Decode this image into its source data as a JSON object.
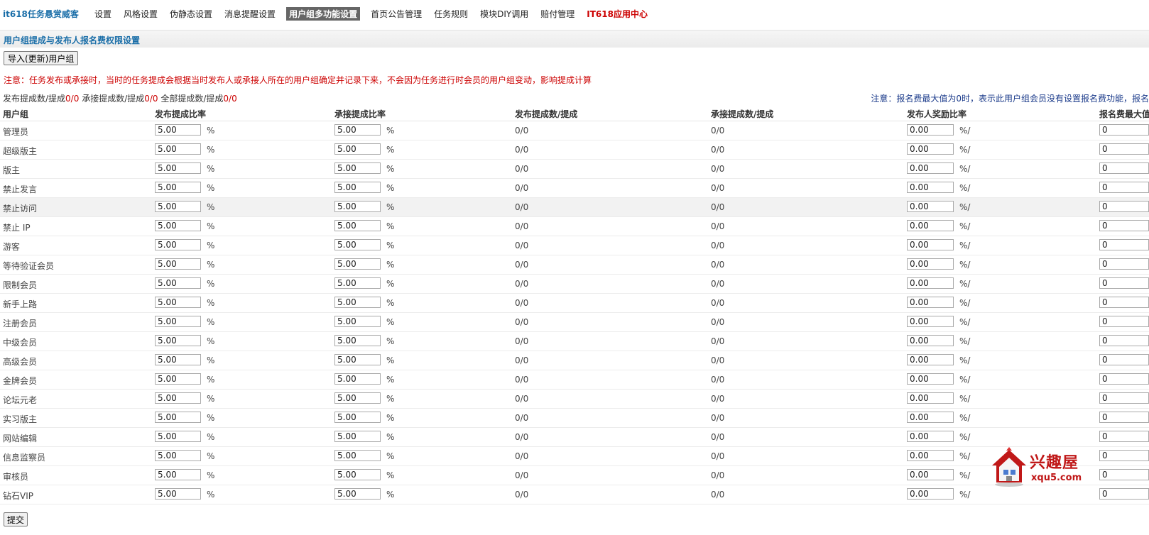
{
  "nav": {
    "brand": "it618任务悬赏威客",
    "items": [
      {
        "label": "设置"
      },
      {
        "label": "风格设置"
      },
      {
        "label": "伪静态设置"
      },
      {
        "label": "消息提醒设置"
      },
      {
        "label": "用户组多功能设置",
        "active": true
      },
      {
        "label": "首页公告管理"
      },
      {
        "label": "任务规则"
      },
      {
        "label": "模块DIY调用"
      },
      {
        "label": "赔付管理"
      },
      {
        "label": "IT618应用中心",
        "highlight": true
      }
    ]
  },
  "section_title": "用户组提成与发布人报名费权限设置",
  "import_button": "导入(更新)用户组",
  "notice": "注意：任务发布或承接时，当时的任务提成会根据当时发布人或承接人所在的用户组确定并记录下来，不会因为任务进行时会员的用户组变动，影响提成计算",
  "stats": {
    "label1": "发布提成数/提成",
    "value1": "0/0",
    "label2": "承接提成数/提成",
    "value2": "0/0",
    "label3": "全部提成数/提成",
    "value3": "0/0"
  },
  "right_note": "注意：报名费最大值为0时，表示此用户组会员没有设置报名费功能，报名",
  "table": {
    "headers": [
      "用户组",
      "发布提成比率",
      "承接提成比率",
      "发布提成数/提成",
      "承接提成数/提成",
      "发布人奖励比率",
      "报名费最大值"
    ],
    "rows": [
      {
        "group": "管理员",
        "pub_rate": "5.00",
        "take_rate": "5.00",
        "pub_count": "0/0",
        "take_count": "0/0",
        "reward_rate": "0.00",
        "max_fee": "0"
      },
      {
        "group": "超级版主",
        "pub_rate": "5.00",
        "take_rate": "5.00",
        "pub_count": "0/0",
        "take_count": "0/0",
        "reward_rate": "0.00",
        "max_fee": "0"
      },
      {
        "group": "版主",
        "pub_rate": "5.00",
        "take_rate": "5.00",
        "pub_count": "0/0",
        "take_count": "0/0",
        "reward_rate": "0.00",
        "max_fee": "0"
      },
      {
        "group": "禁止发言",
        "pub_rate": "5.00",
        "take_rate": "5.00",
        "pub_count": "0/0",
        "take_count": "0/0",
        "reward_rate": "0.00",
        "max_fee": "0"
      },
      {
        "group": "禁止访问",
        "pub_rate": "5.00",
        "take_rate": "5.00",
        "pub_count": "0/0",
        "take_count": "0/0",
        "reward_rate": "0.00",
        "max_fee": "0"
      },
      {
        "group": "禁止 IP",
        "pub_rate": "5.00",
        "take_rate": "5.00",
        "pub_count": "0/0",
        "take_count": "0/0",
        "reward_rate": "0.00",
        "max_fee": "0"
      },
      {
        "group": "游客",
        "pub_rate": "5.00",
        "take_rate": "5.00",
        "pub_count": "0/0",
        "take_count": "0/0",
        "reward_rate": "0.00",
        "max_fee": "0"
      },
      {
        "group": "等待验证会员",
        "pub_rate": "5.00",
        "take_rate": "5.00",
        "pub_count": "0/0",
        "take_count": "0/0",
        "reward_rate": "0.00",
        "max_fee": "0"
      },
      {
        "group": "限制会员",
        "pub_rate": "5.00",
        "take_rate": "5.00",
        "pub_count": "0/0",
        "take_count": "0/0",
        "reward_rate": "0.00",
        "max_fee": "0"
      },
      {
        "group": "新手上路",
        "pub_rate": "5.00",
        "take_rate": "5.00",
        "pub_count": "0/0",
        "take_count": "0/0",
        "reward_rate": "0.00",
        "max_fee": "0"
      },
      {
        "group": "注册会员",
        "pub_rate": "5.00",
        "take_rate": "5.00",
        "pub_count": "0/0",
        "take_count": "0/0",
        "reward_rate": "0.00",
        "max_fee": "0"
      },
      {
        "group": "中级会员",
        "pub_rate": "5.00",
        "take_rate": "5.00",
        "pub_count": "0/0",
        "take_count": "0/0",
        "reward_rate": "0.00",
        "max_fee": "0"
      },
      {
        "group": "高级会员",
        "pub_rate": "5.00",
        "take_rate": "5.00",
        "pub_count": "0/0",
        "take_count": "0/0",
        "reward_rate": "0.00",
        "max_fee": "0"
      },
      {
        "group": "金牌会员",
        "pub_rate": "5.00",
        "take_rate": "5.00",
        "pub_count": "0/0",
        "take_count": "0/0",
        "reward_rate": "0.00",
        "max_fee": "0"
      },
      {
        "group": "论坛元老",
        "pub_rate": "5.00",
        "take_rate": "5.00",
        "pub_count": "0/0",
        "take_count": "0/0",
        "reward_rate": "0.00",
        "max_fee": "0"
      },
      {
        "group": "实习版主",
        "pub_rate": "5.00",
        "take_rate": "5.00",
        "pub_count": "0/0",
        "take_count": "0/0",
        "reward_rate": "0.00",
        "max_fee": "0"
      },
      {
        "group": "网站编辑",
        "pub_rate": "5.00",
        "take_rate": "5.00",
        "pub_count": "0/0",
        "take_count": "0/0",
        "reward_rate": "0.00",
        "max_fee": "0"
      },
      {
        "group": "信息监察员",
        "pub_rate": "5.00",
        "take_rate": "5.00",
        "pub_count": "0/0",
        "take_count": "0/0",
        "reward_rate": "0.00",
        "max_fee": "0"
      },
      {
        "group": "审核员",
        "pub_rate": "5.00",
        "take_rate": "5.00",
        "pub_count": "0/0",
        "take_count": "0/0",
        "reward_rate": "0.00",
        "max_fee": "0"
      },
      {
        "group": "钻石VIP",
        "pub_rate": "5.00",
        "take_rate": "5.00",
        "pub_count": "0/0",
        "take_count": "0/0",
        "reward_rate": "0.00",
        "max_fee": "0"
      }
    ],
    "hover_row": 4,
    "percent_sign": "%",
    "percent_slash": "%/"
  },
  "submit_button": "提交",
  "watermark": {
    "title": "兴趣屋",
    "url": "xqu5.com",
    "icon": "house-icon"
  },
  "colors": {
    "brand": "#1a6ea8",
    "notice": "#cc0000",
    "active_tab": "#666666",
    "watermark": "#c01818"
  }
}
